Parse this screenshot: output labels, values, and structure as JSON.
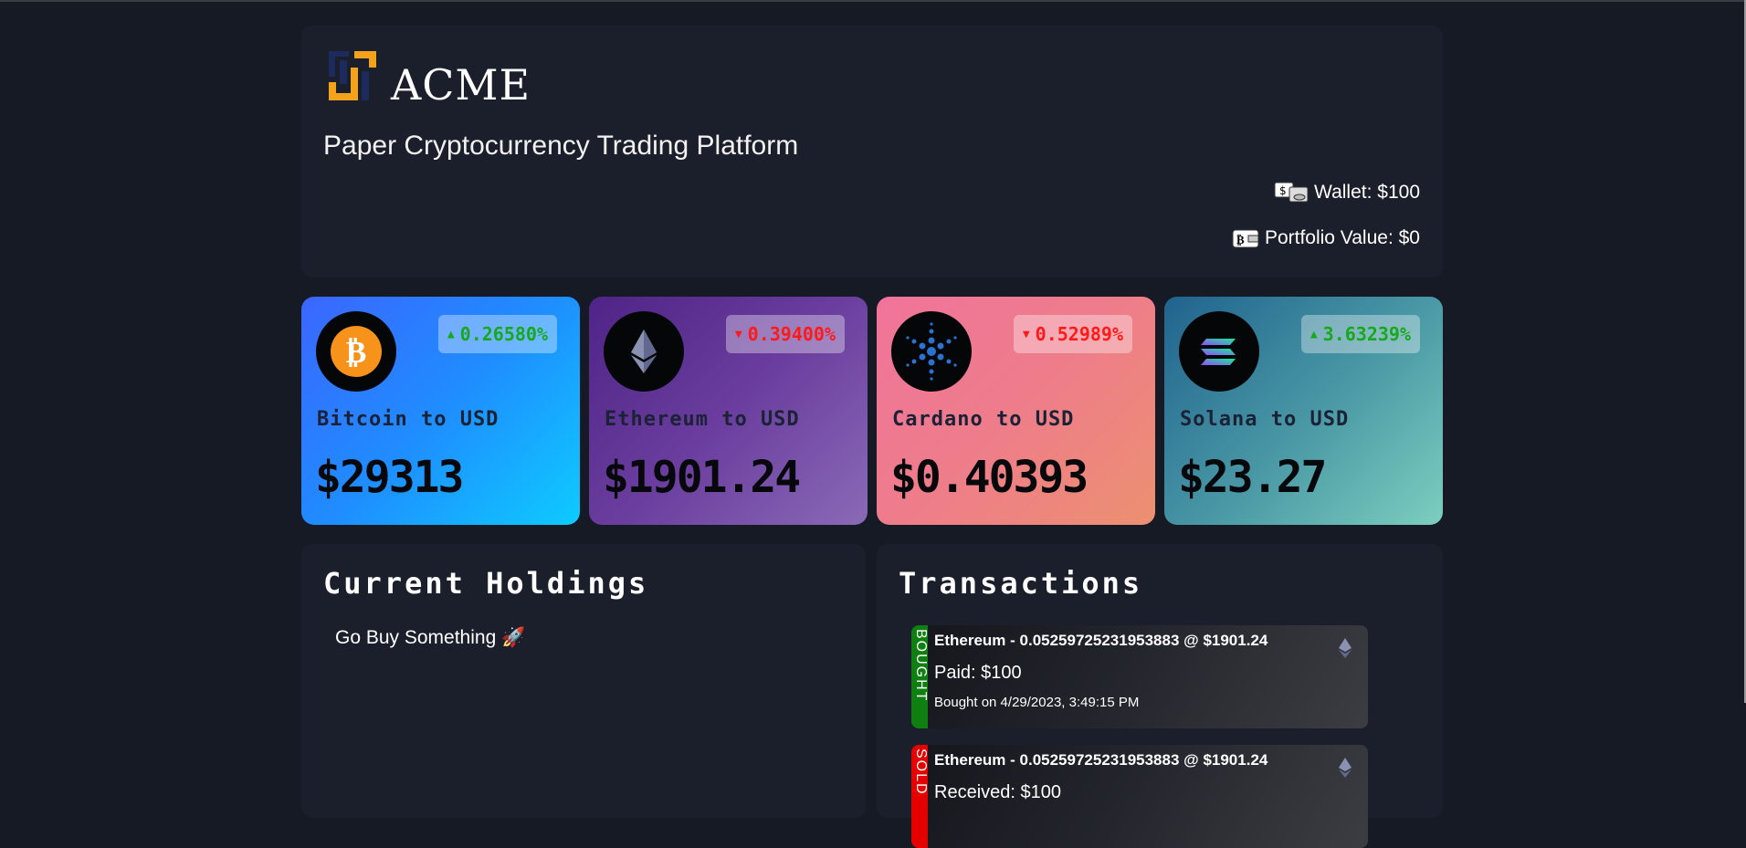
{
  "header": {
    "brand": "ACME",
    "subtitle": "Paper Cryptocurrency Trading Platform",
    "wallet_label": "Wallet: $100",
    "portfolio_label": "Portfolio Value: $0"
  },
  "coins": [
    {
      "name": "Bitcoin to USD",
      "price": "$29313",
      "change": "0.26580%",
      "direction": "up",
      "icon": "bitcoin-icon"
    },
    {
      "name": "Ethereum to USD",
      "price": "$1901.24",
      "change": "0.39400%",
      "direction": "down",
      "icon": "ethereum-icon"
    },
    {
      "name": "Cardano to USD",
      "price": "$0.40393",
      "change": "0.52989%",
      "direction": "down",
      "icon": "cardano-icon"
    },
    {
      "name": "Solana to USD",
      "price": "$23.27",
      "change": "3.63239%",
      "direction": "up",
      "icon": "solana-icon"
    }
  ],
  "holdings": {
    "title": "Current Holdings",
    "empty_message": "Go Buy Something 🚀"
  },
  "transactions": {
    "title": "Transactions",
    "items": [
      {
        "type": "BOUGHT",
        "summary": "Ethereum - 0.05259725231953883 @ $1901.24",
        "amount": "Paid: $100",
        "date": "Bought on 4/29/2023, 3:49:15 PM",
        "icon": "ethereum-icon"
      },
      {
        "type": "SOLD",
        "summary": "Ethereum - 0.05259725231953883 @ $1901.24",
        "amount": "Received: $100",
        "date": "",
        "icon": "ethereum-icon"
      }
    ]
  },
  "colors": {
    "background": "#151a25",
    "panel": "#1b1f2b",
    "up": "#18a81c",
    "down": "#ff1a1a",
    "bought": "#0f7f12",
    "sold": "#e50000"
  }
}
